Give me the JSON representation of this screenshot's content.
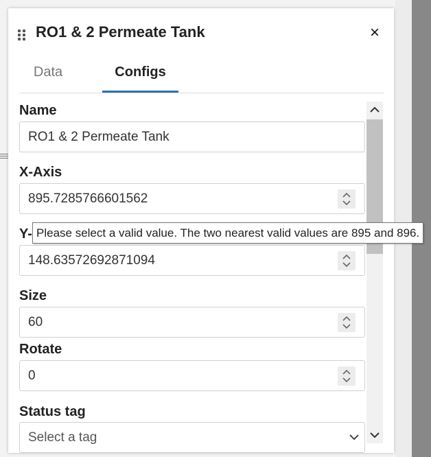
{
  "panel": {
    "title": "RO1 & 2 Permeate Tank",
    "close_glyph": "×"
  },
  "tabs": [
    {
      "label": "Data",
      "active": false
    },
    {
      "label": "Configs",
      "active": true
    }
  ],
  "form": {
    "name": {
      "label": "Name",
      "value": "RO1 & 2 Permeate Tank"
    },
    "x_axis": {
      "label": "X-Axis",
      "value": "895.7285766601562"
    },
    "y_axis": {
      "label": "Y-",
      "value": "148.63572692871094"
    },
    "size": {
      "label": "Size",
      "value": "60"
    },
    "rotate": {
      "label": "Rotate",
      "value": "0"
    },
    "status_tag": {
      "label": "Status tag",
      "placeholder": "Select a tag"
    }
  },
  "tooltip": {
    "text": "Please select a valid value. The two nearest valid values are 895 and 896."
  },
  "icons": {
    "drag": "drag-handle-icon",
    "close": "close-icon",
    "spinner": "spinner-arrows-icon",
    "select": "chevron-down-icon",
    "scroll_up": "scroll-up-icon",
    "scroll_down": "scroll-down-icon"
  },
  "colors": {
    "active_tab_underline": "#2f6fb7",
    "tooltip_border": "#767676"
  }
}
